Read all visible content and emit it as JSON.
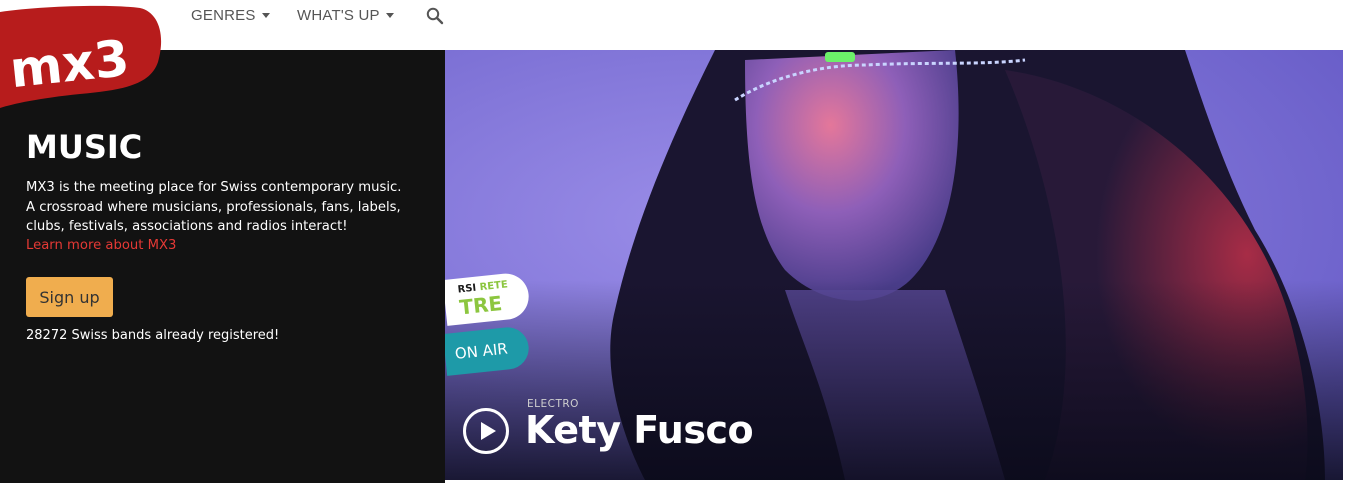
{
  "nav": {
    "genres_label": "GENRES",
    "whats_up_label": "WHAT'S UP",
    "search_icon": "search-icon"
  },
  "logo": {
    "text": "mx3",
    "color": "#b71c1c"
  },
  "intro": {
    "title": "MUSIC",
    "description": "MX3 is the meeting place for Swiss contemporary music. A crossroad where musicians, professionals, fans, labels, clubs, festivals, associations and radios interact!",
    "learn_more": "Learn more about MX3",
    "signup_label": "Sign up",
    "registered_text": "28272 Swiss bands already registered!"
  },
  "hero": {
    "genre": "ELECTRO",
    "artist": "Kety Fusco",
    "play_icon": "play-icon",
    "radio_badge": {
      "line1_a": "RSI",
      "line1_b": "RETE",
      "line2": "TRE"
    },
    "on_air": "ON AIR"
  },
  "colors": {
    "accent_red": "#e53935",
    "signup_orange": "#f0ad4e",
    "panel_dark": "#121212",
    "hero_purple": "#7b6fd6",
    "onair_teal": "#1e9aa8",
    "rete_green": "#8cc63f"
  }
}
